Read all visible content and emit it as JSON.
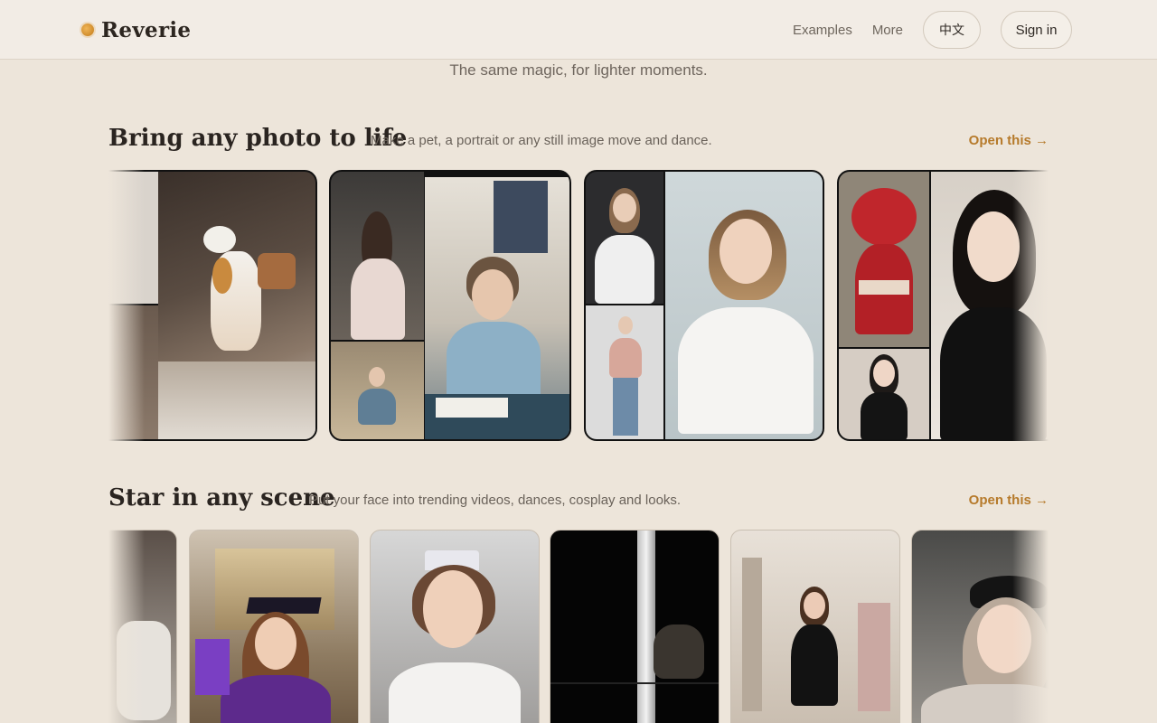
{
  "header": {
    "logo": "Reverie",
    "nav": {
      "examples": "Examples",
      "more": "More",
      "language": "中文",
      "sign_in": "Sign in"
    }
  },
  "hero": {
    "tagline": "The same magic, for lighter moments."
  },
  "sections": [
    {
      "title": "Bring any photo to life",
      "subtitle": "Make a pet, a portrait or any still image move and dance.",
      "link": "Open this →",
      "cards": [
        "cat-dancing",
        "girl-webcam-pointing",
        "woman-sweater-pointing",
        "red-plush-and-woman"
      ]
    },
    {
      "title": "Star in any scene",
      "subtitle": "Put your face into trending videos, dances, cosplay and looks.",
      "link": "Open this →",
      "cards": [
        "partial-left",
        "graduation-purple",
        "princess-tiara",
        "night-pole",
        "hallway-black-dress",
        "cap-selfie"
      ]
    }
  ],
  "colors": {
    "background": "#ede5da",
    "accent": "#b67a2b",
    "logo_dot": "#d08c2c"
  }
}
